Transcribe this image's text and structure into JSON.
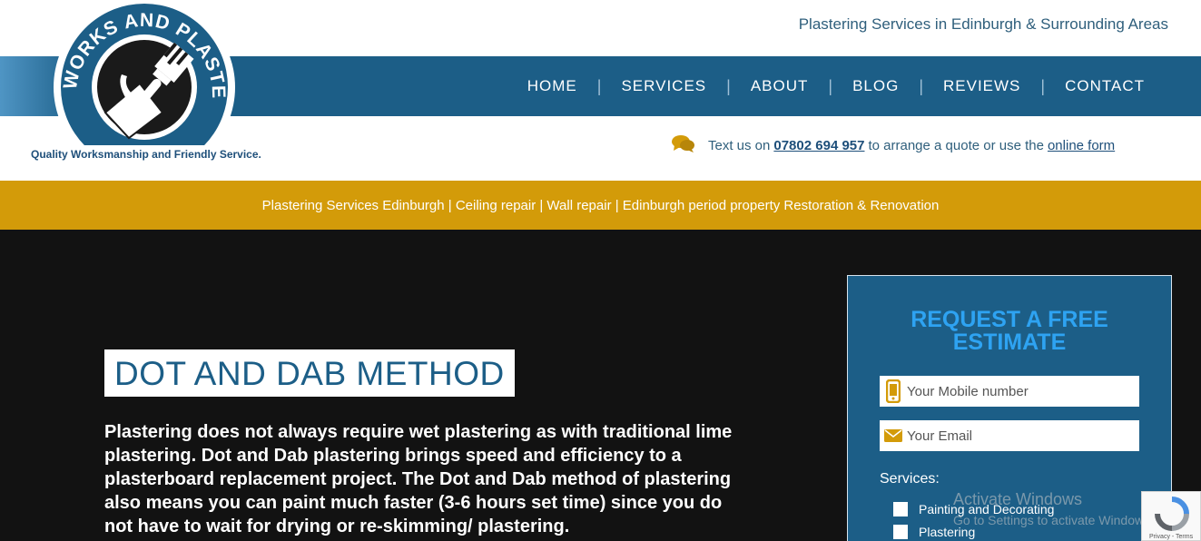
{
  "header": {
    "tagline": "Plastering Services in Edinburgh & Surrounding Areas",
    "logo_text": "PAINTWORKS AND PLASTERING",
    "logo_subtitle": "Quality Worksmanship and Friendly Service."
  },
  "nav": {
    "items": [
      {
        "label": "HOME"
      },
      {
        "label": "SERVICES"
      },
      {
        "label": "ABOUT"
      },
      {
        "label": "BLOG"
      },
      {
        "label": "REVIEWS"
      },
      {
        "label": "CONTACT"
      }
    ],
    "separator": "|"
  },
  "contact": {
    "prefix": "Text us on",
    "phone": "07802 694 957",
    "middle": "to arrange a quote or use the",
    "form_link": "online form"
  },
  "banner": {
    "text": "Plastering Services Edinburgh | Ceiling repair | Wall repair | Edinburgh period property Restoration & Renovation"
  },
  "hero": {
    "title": "DOT AND DAB METHOD",
    "body": "Plastering does not always require wet plastering as with traditional lime plastering. Dot and Dab plastering brings speed and efficiency to a plasterboard replacement project. The Dot and Dab method of plastering also means you can paint much faster (3-6 hours set time) since you do not have to wait for drying or re-skimming/ plastering."
  },
  "estimate_form": {
    "title_line1": "REQUEST A FREE",
    "title_line2": "ESTIMATE",
    "mobile_placeholder": "Your Mobile number",
    "email_placeholder": "Your Email",
    "services_label": "Services:",
    "services": [
      {
        "label": "Painting and Decorating",
        "checked": false
      },
      {
        "label": "Plastering",
        "checked": false
      }
    ]
  },
  "overlay": {
    "activate_title": "Activate Windows",
    "activate_sub": "Go to Settings to activate Windows.",
    "recaptcha_terms": "Privacy - Terms"
  },
  "colors": {
    "brand_blue": "#1c5e87",
    "accent_yellow": "#d39b09",
    "title_blue": "#2ea3f2",
    "hero_bg": "#121212"
  },
  "icons": {
    "contact": "chat-bubbles-icon",
    "mobile_field": "mobile-phone-icon",
    "email_field": "envelope-icon",
    "logo": "paintbrush-trowel-icon",
    "recaptcha": "recaptcha-icon"
  }
}
